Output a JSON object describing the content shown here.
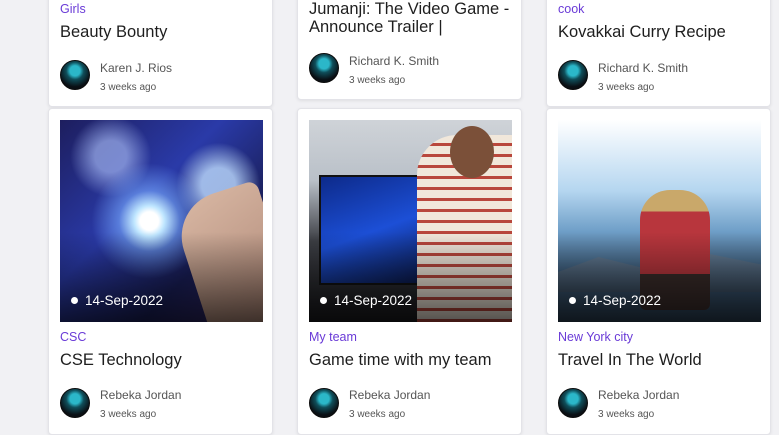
{
  "top_cards": [
    {
      "category": "Girls",
      "title": "Beauty Bounty",
      "author": "Karen J. Rios",
      "time": "3 weeks ago"
    },
    {
      "category": "",
      "title_line1": "Jumanji: The Video Game -",
      "title_line2": "Announce Trailer |",
      "author": "Richard K. Smith",
      "time": "3 weeks ago"
    },
    {
      "category": "cook",
      "title": "Kovakkai Curry Recipe",
      "author": "Richard K. Smith",
      "time": "3 weeks ago"
    }
  ],
  "bottom_cards": [
    {
      "date": "14-Sep-2022",
      "category": "CSC",
      "title": "CSE Technology",
      "author": "Rebeka Jordan",
      "time": "3 weeks ago",
      "image": "technology-hologram-image"
    },
    {
      "date": "14-Sep-2022",
      "category": "My team",
      "title": "Game time with my team",
      "author": "Rebeka Jordan",
      "time": "3 weeks ago",
      "image": "gamer-headset-image"
    },
    {
      "date": "14-Sep-2022",
      "category": "New York city",
      "title": "Travel In The World",
      "author": "Rebeka Jordan",
      "time": "3 weeks ago",
      "image": "traveler-mountain-image"
    }
  ],
  "colors": {
    "category": "#6a3bd7",
    "background": "#f1f1f4",
    "title": "#1e1e1e"
  }
}
